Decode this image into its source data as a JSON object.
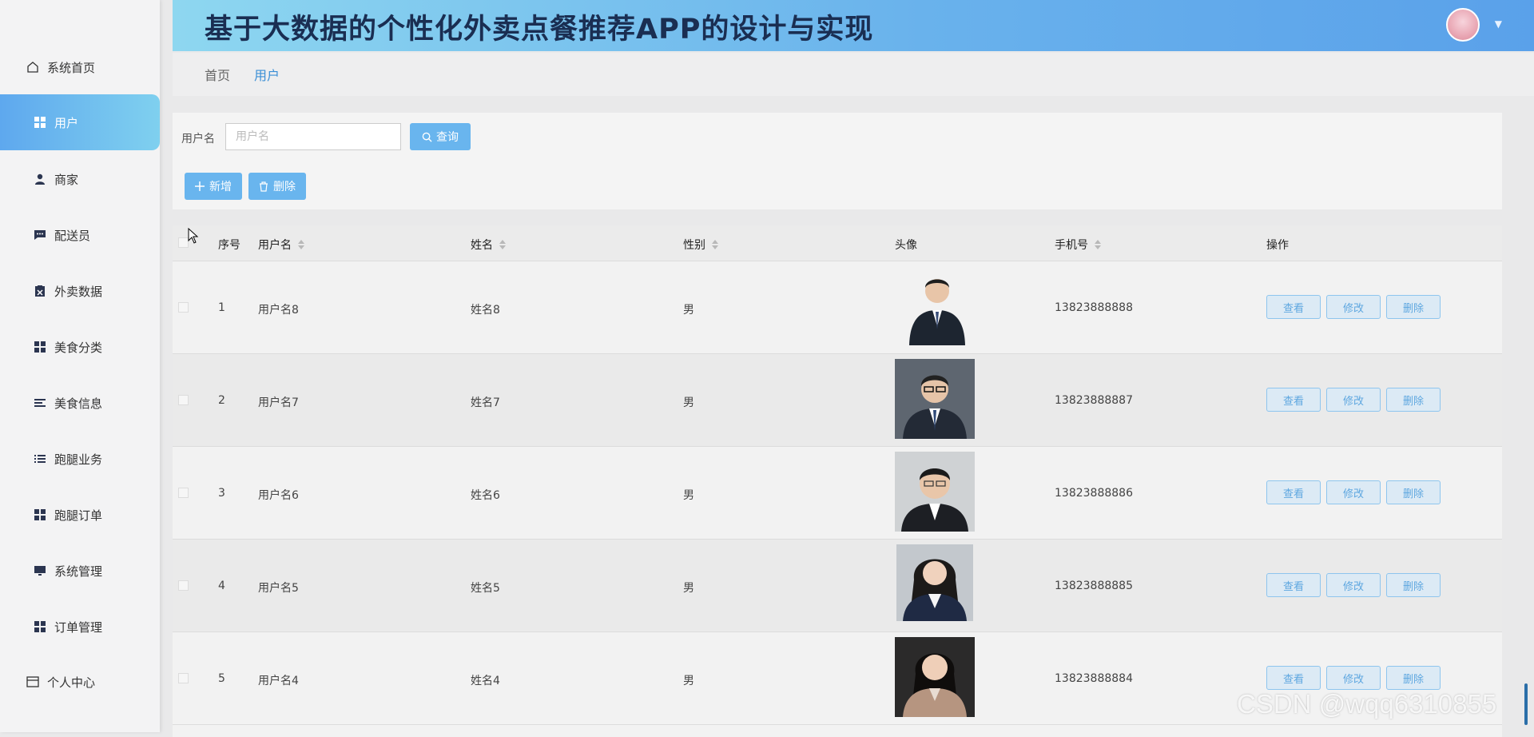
{
  "header": {
    "title": "基于大数据的个性化外卖点餐推荐APP的设计与实现"
  },
  "sidebar": {
    "items": [
      {
        "label": "系统首页",
        "icon": "home-icon"
      },
      {
        "label": "用户",
        "icon": "grid-icon",
        "active": true
      },
      {
        "label": "商家",
        "icon": "user-icon"
      },
      {
        "label": "配送员",
        "icon": "chat-icon"
      },
      {
        "label": "外卖数据",
        "icon": "clipboard-icon"
      },
      {
        "label": "美食分类",
        "icon": "grid-icon"
      },
      {
        "label": "美食信息",
        "icon": "list-icon"
      },
      {
        "label": "跑腿业务",
        "icon": "list-icon"
      },
      {
        "label": "跑腿订单",
        "icon": "grid-icon"
      },
      {
        "label": "系统管理",
        "icon": "monitor-icon"
      },
      {
        "label": "订单管理",
        "icon": "grid-icon"
      },
      {
        "label": "个人中心",
        "icon": "card-icon"
      }
    ]
  },
  "breadcrumb": {
    "home": "首页",
    "current": "用户"
  },
  "search": {
    "label": "用户名",
    "placeholder": "用户名",
    "query_label": "查询"
  },
  "toolbar": {
    "add_label": "新增",
    "delete_label": "删除"
  },
  "table": {
    "columns": [
      "序号",
      "用户名",
      "姓名",
      "性别",
      "头像",
      "手机号",
      "操作"
    ],
    "actions": [
      "查看",
      "修改",
      "删除"
    ],
    "rows": [
      {
        "index": "1",
        "username": "用户名8",
        "name": "姓名8",
        "gender": "男",
        "phone": "13823888888"
      },
      {
        "index": "2",
        "username": "用户名7",
        "name": "姓名7",
        "gender": "男",
        "phone": "13823888887"
      },
      {
        "index": "3",
        "username": "用户名6",
        "name": "姓名6",
        "gender": "男",
        "phone": "13823888886"
      },
      {
        "index": "4",
        "username": "用户名5",
        "name": "姓名5",
        "gender": "男",
        "phone": "13823888885"
      },
      {
        "index": "5",
        "username": "用户名4",
        "name": "姓名4",
        "gender": "男",
        "phone": "13823888884"
      }
    ]
  },
  "watermark": "CSDN @wqq6310855"
}
